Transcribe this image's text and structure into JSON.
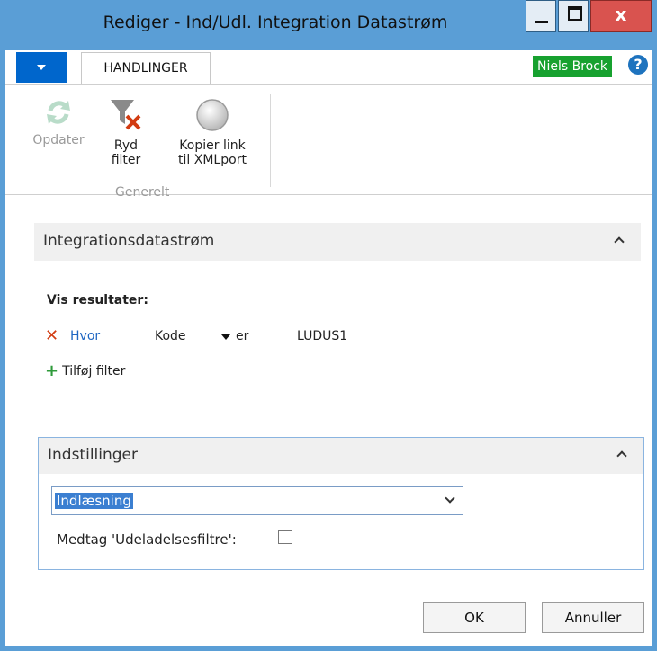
{
  "window": {
    "title": "Rediger - Ind/Udl. Integration Datastrøm",
    "controls": {
      "minimize_icon": "minimize-icon",
      "maximize_icon": "maximize-icon",
      "close_glyph": "x"
    }
  },
  "tabs": {
    "menu_icon": "chevron-down-icon",
    "active_tab": "HANDLINGER",
    "user": "Niels Brock",
    "help_glyph": "?"
  },
  "ribbon": {
    "buttons": [
      {
        "label_line1": "Opdater",
        "label_line2": "",
        "icon": "refresh-icon",
        "enabled": false
      },
      {
        "label_line1": "Ryd",
        "label_line2": "filter",
        "icon": "clear-filter-icon",
        "enabled": true
      },
      {
        "label_line1": "Kopier link",
        "label_line2": "til XMLport",
        "icon": "link-circle-icon",
        "enabled": true
      }
    ],
    "group_label": "Generelt"
  },
  "filter_panel": {
    "title": "Integrationsdatastrøm",
    "results_label": "Vis resultater:",
    "filter": {
      "where": "Hvor",
      "field": "Kode",
      "operator": "er",
      "value": "LUDUS1"
    },
    "add_filter": "Tilføj filter"
  },
  "settings_panel": {
    "title": "Indstillinger",
    "direction_value": "Indlæsning",
    "include_exclusion_label": "Medtag 'Udeladelsesfiltre':",
    "include_exclusion_checked": false
  },
  "footer": {
    "ok_label": "OK",
    "cancel_label": "Annuller"
  },
  "colors": {
    "accent": "#0066cc",
    "titlebar": "#5a9ed6",
    "user_badge": "#17a12f",
    "delete": "#d23c12",
    "add": "#2e9a3a"
  }
}
